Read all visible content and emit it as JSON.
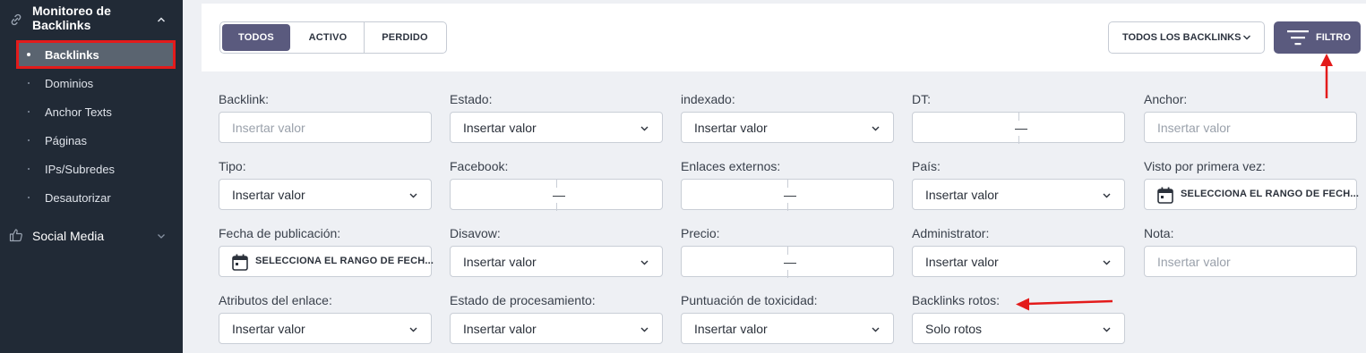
{
  "sidebar": {
    "group_backlinks": {
      "label": "Monitoreo de Backlinks",
      "line1": "Monitoreo de",
      "line2": "Backlinks",
      "icon": "link-icon",
      "chevron": "chevron-up-icon"
    },
    "items": [
      {
        "label": "Backlinks",
        "active": true
      },
      {
        "label": "Dominios"
      },
      {
        "label": "Anchor Texts"
      },
      {
        "label": "Páginas"
      },
      {
        "label": "IPs/Subredes"
      },
      {
        "label": "Desautorizar"
      }
    ],
    "group_social": {
      "label": "Social Media",
      "icon": "thumbs-up-icon",
      "chevron": "chevron-down-icon"
    }
  },
  "toolbar": {
    "tabs": [
      "TODOS",
      "ACTIVO",
      "PERDIDO"
    ],
    "active_tab": "TODOS",
    "dropdown_label": "TODOS LOS BACKLINKS",
    "filter_label": "FILTRO"
  },
  "filters": {
    "placeholder": "Insertar valor",
    "date_placeholder": "SELECCIONA EL RANGO DE FECH...",
    "range_separator": "—",
    "backlink": {
      "label": "Backlink:"
    },
    "estado": {
      "label": "Estado:"
    },
    "indexado": {
      "label": "indexado:"
    },
    "dt": {
      "label": "DT:"
    },
    "anchor": {
      "label": "Anchor:"
    },
    "tipo": {
      "label": "Tipo:"
    },
    "facebook": {
      "label": "Facebook:"
    },
    "enlaces_externos": {
      "label": "Enlaces externos:"
    },
    "pais": {
      "label": "País:"
    },
    "visto": {
      "label": "Visto por primera vez:"
    },
    "fecha_publicacion": {
      "label": "Fecha de publicación:"
    },
    "disavow": {
      "label": "Disavow:"
    },
    "precio": {
      "label": "Precio:"
    },
    "administrator": {
      "label": "Administrator:"
    },
    "nota": {
      "label": "Nota:"
    },
    "atributos": {
      "label": "Atributos del enlace:"
    },
    "estado_procesamiento": {
      "label": "Estado de procesamiento:"
    },
    "toxicidad": {
      "label": "Puntuación de toxicidad:"
    },
    "backlinks_rotos": {
      "label": "Backlinks rotos:",
      "value": "Solo rotos"
    }
  },
  "colors": {
    "sidebar_bg": "#212a36",
    "accent": "#5a5a7e",
    "highlight": "#e31b1b"
  }
}
